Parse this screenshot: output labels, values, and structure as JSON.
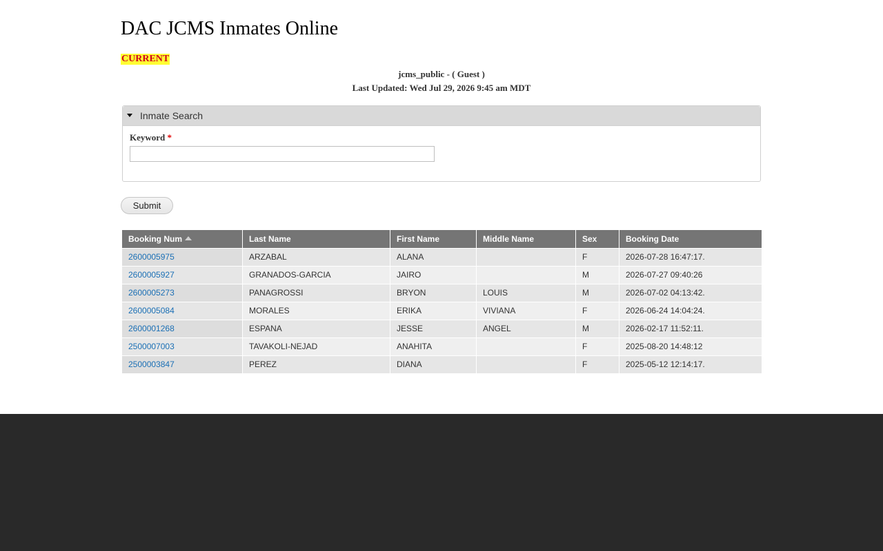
{
  "header": {
    "title": "DAC JCMS Inmates Online",
    "status": "CURRENT",
    "user_line": "jcms_public - ( Guest )",
    "updated_line": "Last Updated: Wed Jul 29, 2026 9:45 am MDT"
  },
  "search": {
    "legend": "Inmate Search",
    "keyword_label": "Keyword",
    "required_mark": "*",
    "keyword_value": "",
    "submit_label": "Submit"
  },
  "table": {
    "columns": [
      "Booking Num",
      "Last Name",
      "First Name",
      "Middle Name",
      "Sex",
      "Booking Date"
    ],
    "sorted_column": "Booking Num",
    "sort_direction": "ascending",
    "rows": [
      {
        "booking_num": "2600005975",
        "last_name": "ARZABAL",
        "first_name": "ALANA",
        "middle_name": "",
        "sex": "F",
        "booking_date": "2026-07-28 16:47:17."
      },
      {
        "booking_num": "2600005927",
        "last_name": "GRANADOS-GARCIA",
        "first_name": "JAIRO",
        "middle_name": "",
        "sex": "M",
        "booking_date": "2026-07-27 09:40:26"
      },
      {
        "booking_num": "2600005273",
        "last_name": "PANAGROSSI",
        "first_name": "BRYON",
        "middle_name": "LOUIS",
        "sex": "M",
        "booking_date": "2026-07-02 04:13:42."
      },
      {
        "booking_num": "2600005084",
        "last_name": "MORALES",
        "first_name": "ERIKA",
        "middle_name": "VIVIANA",
        "sex": "F",
        "booking_date": "2026-06-24 14:04:24."
      },
      {
        "booking_num": "2600001268",
        "last_name": "ESPANA",
        "first_name": "JESSE",
        "middle_name": "ANGEL",
        "sex": "M",
        "booking_date": "2026-02-17 11:52:11."
      },
      {
        "booking_num": "2500007003",
        "last_name": "TAVAKOLI-NEJAD",
        "first_name": "ANAHITA",
        "middle_name": "",
        "sex": "F",
        "booking_date": "2025-08-20 14:48:12"
      },
      {
        "booking_num": "2500003847",
        "last_name": "PEREZ",
        "first_name": "DIANA",
        "middle_name": "",
        "sex": "F",
        "booking_date": "2025-05-12 12:14:17."
      }
    ]
  },
  "colors": {
    "header_bg": "#757575",
    "link": "#1a6fb5",
    "status_highlight": "#ffff33",
    "status_text": "#d0021b",
    "footer_bg": "#292929"
  },
  "icons": {
    "legend_toggle": "caret-down-icon",
    "sort_indicator": "sort-ascending-icon"
  }
}
